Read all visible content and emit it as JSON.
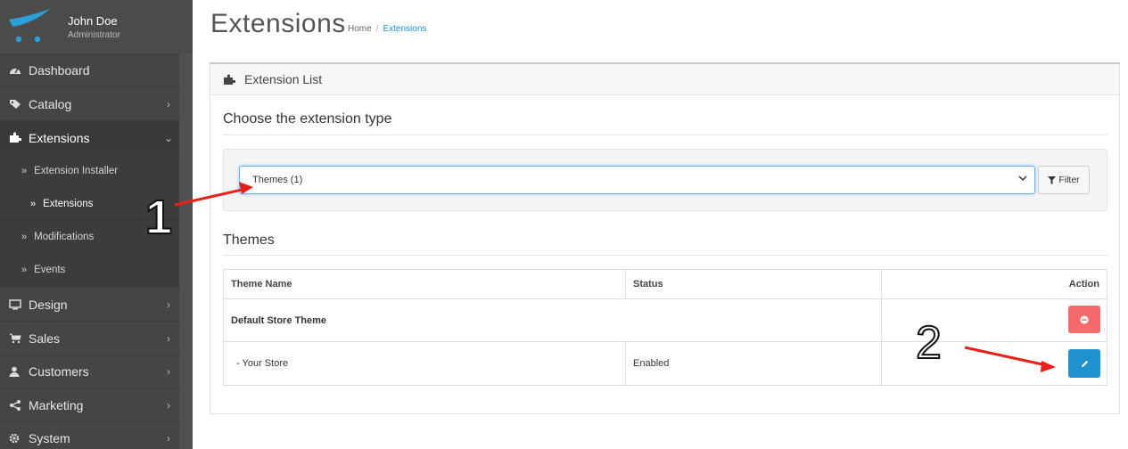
{
  "user": {
    "name": "John Doe",
    "role": "Administrator"
  },
  "nav": {
    "dashboard": "Dashboard",
    "catalog": "Catalog",
    "extensions": "Extensions",
    "design": "Design",
    "sales": "Sales",
    "customers": "Customers",
    "marketing": "Marketing",
    "system": "System",
    "chevron_right": "›",
    "chevron_down": "⌄",
    "sub": {
      "installer": "Extension Installer",
      "extensions": "Extensions",
      "modifications": "Modifications",
      "events": "Events",
      "marker": "»"
    }
  },
  "page": {
    "title": "Extensions",
    "breadcrumb": {
      "home": "Home",
      "separator": "/",
      "current": "Extensions"
    }
  },
  "panel": {
    "heading": "Extension List",
    "choose_title": "Choose the extension type",
    "select_value": "Themes (1)",
    "filter_label": "Filter",
    "themes_title": "Themes"
  },
  "table": {
    "headers": {
      "name": "Theme Name",
      "status": "Status",
      "action": "Action"
    },
    "rows": [
      {
        "name": "Default Store Theme",
        "status": ""
      },
      {
        "name": "-  Your Store",
        "status": "Enabled"
      }
    ]
  },
  "annotations": {
    "step1": "1",
    "step2": "2",
    "arrow_color": "#e8201a"
  },
  "colors": {
    "sidebar": "#454545",
    "primary": "#1e91cf",
    "danger": "#f56b6b"
  }
}
